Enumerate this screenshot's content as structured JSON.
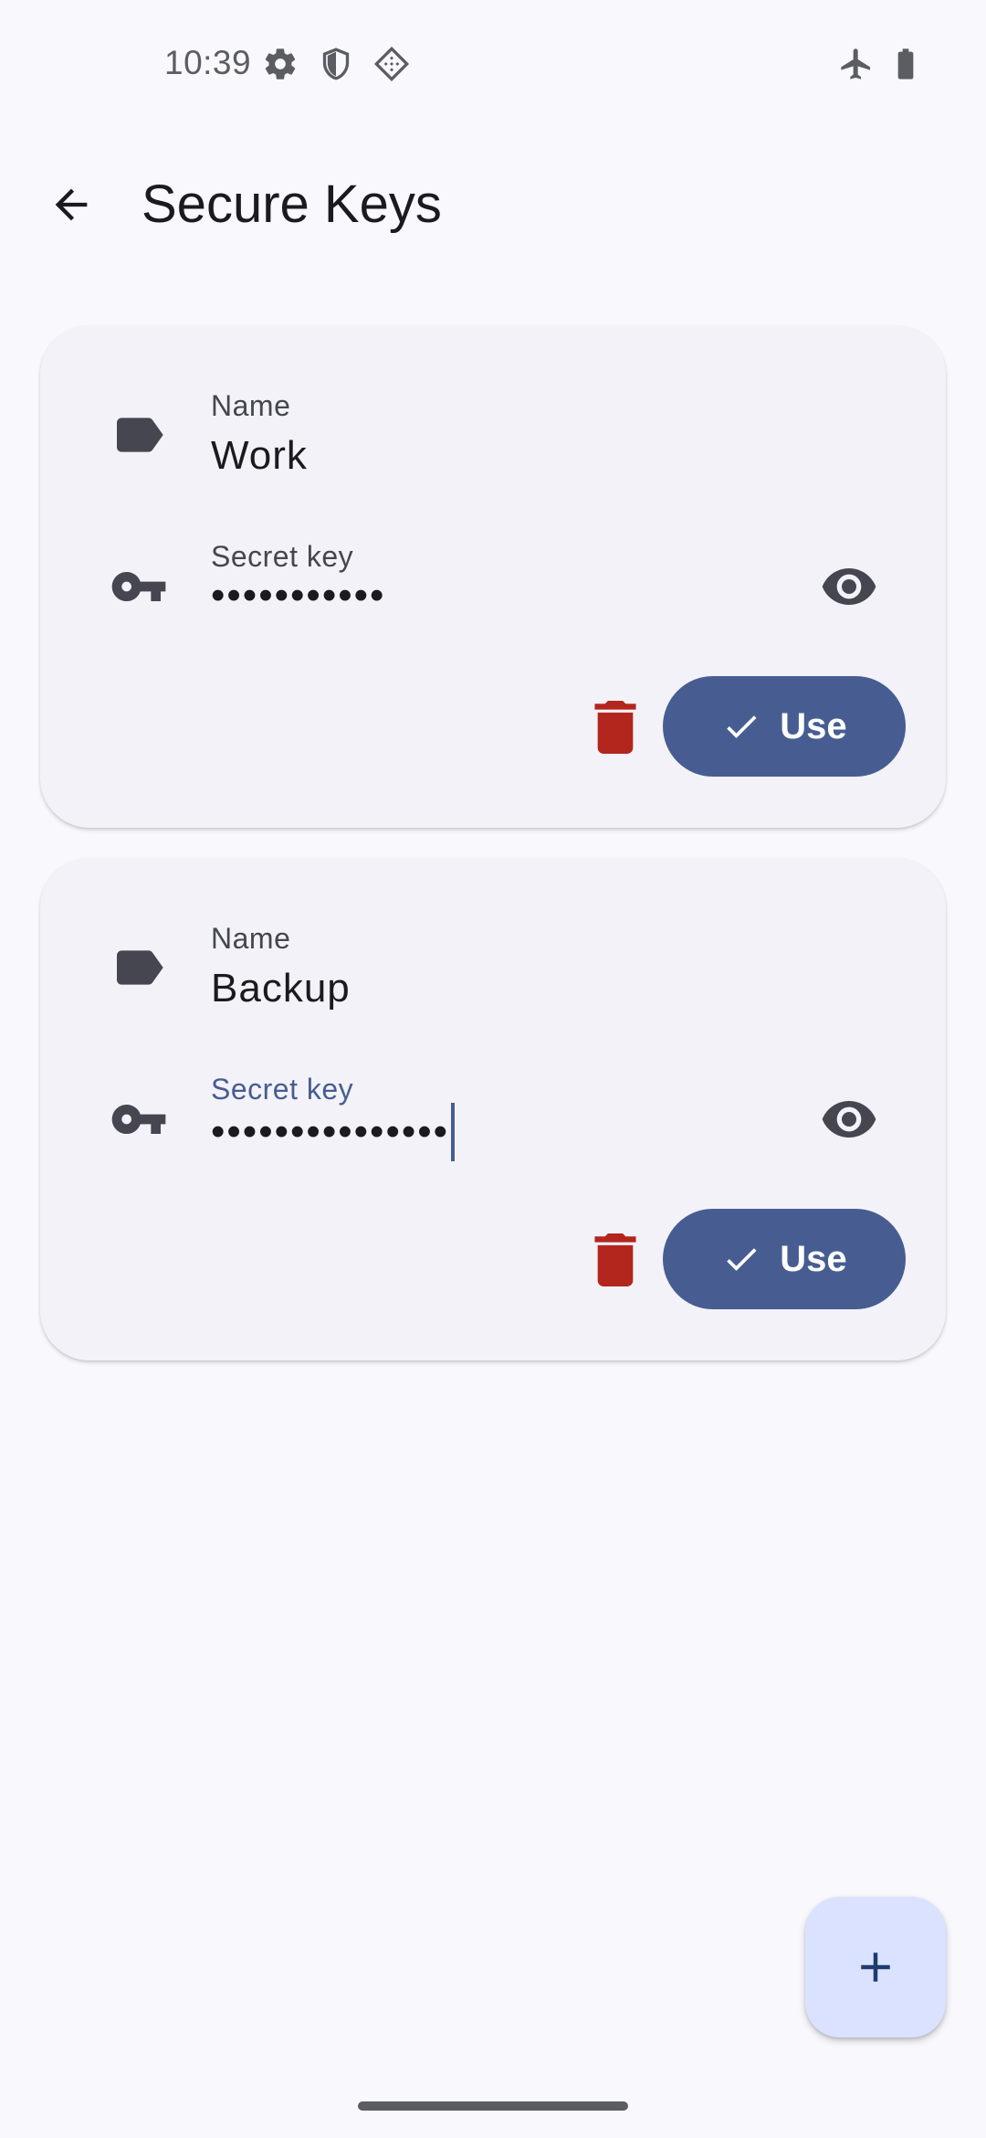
{
  "status_bar": {
    "time": "10:39",
    "left_icons": [
      "settings-icon",
      "shield-icon",
      "vpn-diamond-icon"
    ],
    "right_icons": [
      "airplane-mode-icon",
      "battery-icon"
    ]
  },
  "app_bar": {
    "back_icon": "arrow-back-icon",
    "title": "Secure Keys"
  },
  "keys": [
    {
      "name_label": "Name",
      "name_value": "Work",
      "secret_label": "Secret key",
      "secret_value": "•••••••••••",
      "focused": false,
      "use_label": "Use"
    },
    {
      "name_label": "Name",
      "name_value": "Backup",
      "secret_label": "Secret key",
      "secret_value": "•••••••••••••••",
      "focused": true,
      "use_label": "Use"
    }
  ],
  "fab": {
    "icon": "add-icon"
  },
  "colors": {
    "primary": "#475d92",
    "delete": "#b3261e",
    "surface": "#f3f2f8",
    "background": "#f8f8fd",
    "fab_container": "#dae2ff"
  }
}
